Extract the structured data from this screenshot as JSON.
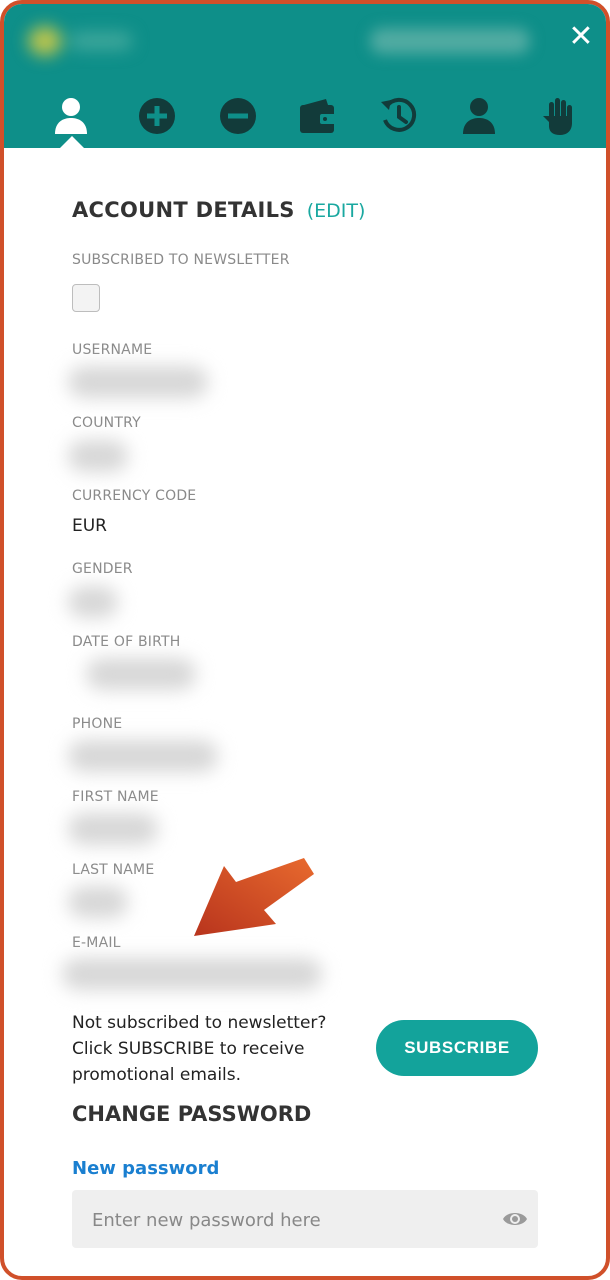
{
  "header": {
    "close_icon": "close-icon",
    "nav": [
      {
        "name": "account-icon"
      },
      {
        "name": "deposit-icon"
      },
      {
        "name": "withdraw-icon"
      },
      {
        "name": "wallet-icon"
      },
      {
        "name": "history-icon"
      },
      {
        "name": "profile-icon"
      },
      {
        "name": "stop-hand-icon"
      }
    ]
  },
  "account": {
    "title": "ACCOUNT DETAILS",
    "edit_label": "(EDIT)",
    "newsletter_label": "SUBSCRIBED TO NEWSLETTER",
    "newsletter_checked": false,
    "fields": {
      "username_label": "USERNAME",
      "country_label": "COUNTRY",
      "currency_label": "CURRENCY CODE",
      "currency_value": "EUR",
      "gender_label": "GENDER",
      "dob_label": "DATE OF BIRTH",
      "phone_label": "PHONE",
      "first_name_label": "FIRST NAME",
      "last_name_label": "LAST NAME",
      "email_label": "E-MAIL"
    }
  },
  "promo": {
    "text": "Not subscribed to newsletter? Click SUBSCRIBE to receive promotional emails.",
    "button_label": "SUBSCRIBE"
  },
  "password": {
    "title": "CHANGE PASSWORD",
    "new_label": "New password",
    "placeholder": "Enter new password here"
  },
  "colors": {
    "header": "#0e8f89",
    "accent": "#13a39b",
    "link_blue": "#1a7fd0",
    "border": "#d0502a",
    "arrow": "#c93f22"
  }
}
